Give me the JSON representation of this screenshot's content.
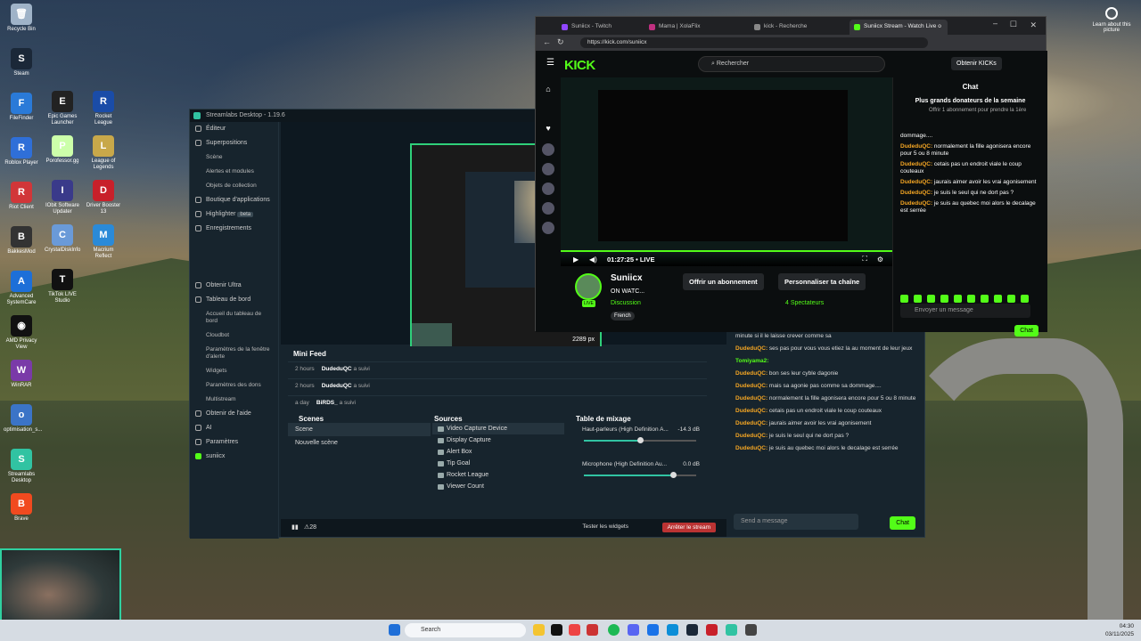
{
  "desktop": {
    "icons": [
      {
        "label": "Recycle Bin",
        "color": "#9fb3c8",
        "glyph": "🗑"
      },
      {
        "label": "Steam",
        "color": "#1b2838",
        "glyph": "S"
      },
      {
        "label": "FileFinder",
        "color": "#2a7ad8",
        "glyph": "F"
      },
      {
        "label": "Roblox Player",
        "color": "#2f6fd8",
        "glyph": "R"
      },
      {
        "label": "Riot Client",
        "color": "#d13639",
        "glyph": "R"
      },
      {
        "label": "BakkesMod",
        "color": "#333",
        "glyph": "B"
      },
      {
        "label": "Advanced SystemCare",
        "color": "#1d6fd8",
        "glyph": "A"
      },
      {
        "label": "AMD Privacy View",
        "color": "#111",
        "glyph": "◉"
      },
      {
        "label": "WinRAR",
        "color": "#7a3aa8",
        "glyph": "W"
      },
      {
        "label": "optimisation_s...",
        "color": "#3b74c7",
        "glyph": "o"
      },
      {
        "label": "Streamlabs Desktop",
        "color": "#31c3a2",
        "glyph": "S"
      },
      {
        "label": "Brave",
        "color": "#f14a1f",
        "glyph": "B"
      }
    ],
    "icons_col2": [
      {
        "label": "Epic Games Launcher",
        "color": "#222",
        "glyph": "E"
      },
      {
        "label": "Porofessor.gg",
        "color": "#cfa",
        "glyph": "P"
      },
      {
        "label": "IObit Software Updater",
        "color": "#3a3a8a",
        "glyph": "I"
      },
      {
        "label": "CrystalDiskInfo",
        "color": "#6a9ad8",
        "glyph": "C"
      },
      {
        "label": "TikTok LIVE Studio",
        "color": "#111",
        "glyph": "T"
      }
    ],
    "icons_col3": [
      {
        "label": "Rocket League",
        "color": "#1a4ca8",
        "glyph": "R"
      },
      {
        "label": "League of Legends",
        "color": "#c8a84a",
        "glyph": "L"
      },
      {
        "label": "Driver Booster 13",
        "color": "#c8202a",
        "glyph": "D"
      },
      {
        "label": "Macrium Reflect",
        "color": "#2a8ad8",
        "glyph": "M"
      }
    ],
    "learn_label": "Learn about this picture"
  },
  "streamlabs": {
    "title": "Streamlabs Desktop - 1.19.6",
    "sidebar": {
      "editor": "Éditeur",
      "overlays": "Superpositions",
      "overlay_subs": [
        "Scène",
        "Alertes et modules",
        "Objets de collection"
      ],
      "appstore": "Boutique d'applications",
      "highlighter": "Highlighter",
      "highlighter_badge": "beta",
      "recordings": "Enregistrements",
      "ultra": "Obtenir Ultra",
      "dashboard": "Tableau de bord",
      "dashboard_subs": [
        "Accueil du tableau de bord",
        "Cloudbot",
        "Paramètres de la fenêtre d'alerte",
        "Widgets",
        "Paramètres des dons",
        "Multistream"
      ],
      "help": "Obtenir de l'aide",
      "ai": "AI",
      "settings": "Paramètres",
      "user": "suniicx"
    },
    "preview_size": "2289 px",
    "minifeed": {
      "title": "Mini Feed",
      "rows": [
        {
          "time": "2 hours",
          "user": "DudeduQC",
          "action": "a suivi"
        },
        {
          "time": "2 hours",
          "user": "DudeduQC",
          "action": "a suivi"
        },
        {
          "time": "a day",
          "user": "BiRDS_",
          "action": "a suivi"
        }
      ]
    },
    "scenes": {
      "title": "Scenes",
      "items": [
        "Scene",
        "Nouvelle scène"
      ]
    },
    "sources": {
      "title": "Sources",
      "items": [
        "Video Capture Device",
        "Display Capture",
        "Alert Box",
        "Tip Goal",
        "Rocket League",
        "Viewer Count"
      ]
    },
    "mixer": {
      "title": "Table de mixage",
      "channels": [
        {
          "name": "Haut-parleurs (High Definition A...",
          "db": "-14.3 dB",
          "level": 0.5
        },
        {
          "name": "Microphone (High Definition Au...",
          "db": "0.0 dB",
          "level": 0.79
        }
      ]
    },
    "bottom": {
      "alerts": "28",
      "test_widgets": "Tester les widgets",
      "stop": "Arrêter le stream"
    },
    "chat": {
      "lines": [
        {
          "user": "",
          "text": "minute si il le laisse crever comme sa"
        },
        {
          "user": "DudeduQC",
          "text": "ses pas pour vous vous etiez la au moment de leur jeux"
        },
        {
          "user": "Tomiyama2:",
          "text": ""
        },
        {
          "user": "DudeduQC",
          "text": "bon ses leur cyble dagonie"
        },
        {
          "user": "DudeduQC",
          "text": "mais sa agonie pas comme sa dommage...."
        },
        {
          "user": "DudeduQC",
          "text": "normalement la fille agonisera encore pour 5 ou 8 minute"
        },
        {
          "user": "DudeduQC",
          "text": "cetais pas un endroit viale le coup couteaux"
        },
        {
          "user": "DudeduQC",
          "text": "jaurais aimer avoir les vrai agonisement"
        },
        {
          "user": "DudeduQC",
          "text": "je suis le seul qui ne dort pas ?"
        },
        {
          "user": "DudeduQC",
          "text": "je suis au quebec moi alors le decalage est serrée"
        }
      ],
      "placeholder": "Send a message",
      "button": "Chat"
    }
  },
  "browser": {
    "tabs": [
      "Suniicx - Twitch",
      "Mama | XolaFlix",
      "kick - Recherche",
      "Suniicx Stream - Watch Live o"
    ],
    "url": "https://kick.com/suniicx",
    "kick": {
      "logo": "KICK",
      "search": "Rechercher",
      "get_kicks": "Obtenir KICKs",
      "time": "01:27:25",
      "live": "LIVE",
      "streamer": "Suniicx",
      "stream_title": "ON WATC...",
      "category": "Discussion",
      "tag": "French",
      "live_badge": "LIVE",
      "subscribe": "Offrir un abonnement",
      "customize": "Personnaliser ta chaîne",
      "viewers": "4 Spectateurs",
      "chat_title": "Chat",
      "donors_title": "Plus grands donateurs de la semaine",
      "donor_text": "Offrir 1 abonnement pour prendre la 1ère",
      "chat_lines": [
        {
          "user": "",
          "text": "dommage...."
        },
        {
          "user": "DudeduQC:",
          "text": "normalement la fille agonisera encore pour 5 ou 8 minute"
        },
        {
          "user": "DudeduQC:",
          "text": "cetais pas un endroit viale le coup couteaux"
        },
        {
          "user": "DudeduQC:",
          "text": "jaurais aimer avoir les vrai agonisement"
        },
        {
          "user": "DudeduQC:",
          "text": "je suis le seul qui ne dort pas ?"
        },
        {
          "user": "DudeduQC:",
          "text": "je suis au quebec moi alors le decalage est serrée"
        }
      ],
      "placeholder": "Envoyer un message",
      "chat_button": "Chat"
    }
  },
  "taskbar": {
    "search": "Search",
    "time": "04:30",
    "date": "03/11/2025"
  }
}
